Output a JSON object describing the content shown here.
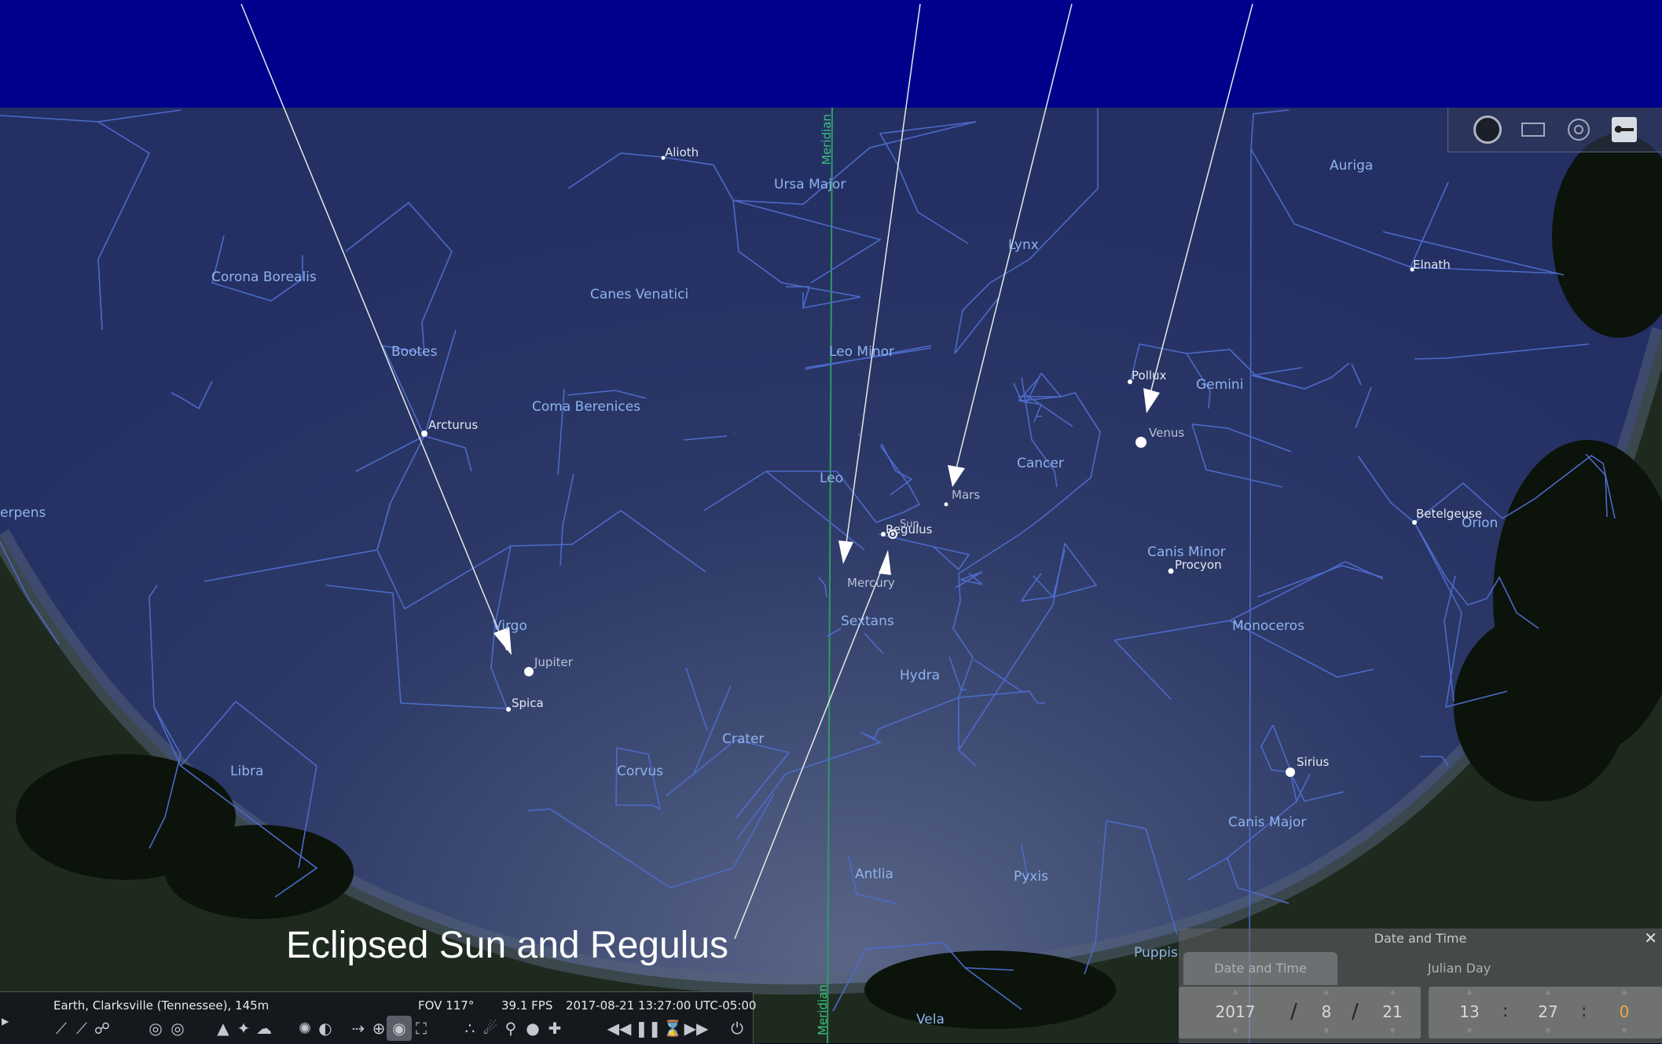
{
  "annotation": "Eclipsed Sun and Regulus",
  "meridian_label": "Meridian",
  "constellations": {
    "corona_borealis": "Corona Borealis",
    "bootes": "Bootes",
    "canes_venatici": "Canes Venatici",
    "ursa_major": "Ursa Major",
    "lynx": "Lynx",
    "auriga": "Auriga",
    "leo_minor": "Leo Minor",
    "coma_berenices": "Coma Berenices",
    "gemini": "Gemini",
    "cancer": "Cancer",
    "leo": "Leo",
    "serpens": "erpens",
    "canis_minor": "Canis Minor",
    "orion": "Orion",
    "virgo": "Virgo",
    "sextans": "Sextans",
    "monoceros": "Monoceros",
    "hydra": "Hydra",
    "crater": "Crater",
    "libra": "Libra",
    "corvus": "Corvus",
    "canis_major": "Canis Major",
    "antlia": "Antlia",
    "pyxis": "Pyxis",
    "puppis": "Puppis",
    "vela": "Vela"
  },
  "stars": {
    "alioth": "Alioth",
    "elnath": "Elnath",
    "arcturus": "Arcturus",
    "pollux": "Pollux",
    "regulus": "Regulus",
    "betelgeuse": "Betelgeuse",
    "procyon": "Procyon",
    "spica": "Spica",
    "sirius": "Sirius"
  },
  "planets": {
    "venus": "Venus",
    "mars": "Mars",
    "sun": "Sun",
    "mercury": "Mercury",
    "jupiter": "Jupiter"
  },
  "status": {
    "location": "Earth, Clarksville (Tennessee), 145m",
    "fov": "FOV 117°",
    "fps": "39.1 FPS",
    "datetime": "2017-08-21 13:27:00 UTC-05:00"
  },
  "toolbar_icons": [
    "constellation-lines-icon",
    "constellation-labels-icon",
    "constellation-art-icon",
    "equatorial-grid-icon",
    "azimuthal-grid-icon",
    "ground-icon",
    "cardinal-points-icon",
    "atmosphere-icon",
    "deep-sky-objects-icon",
    "planet-labels-icon",
    "equatorial-mount-icon",
    "center-selected-icon",
    "night-mode-icon",
    "fullscreen-icon",
    "exoplanets-icon",
    "meteor-showers-icon",
    "search-satellites-icon",
    "ocular-icon",
    "telescope-icon",
    "rewind-icon",
    "pause-icon",
    "real-time-icon",
    "fast-forward-icon",
    "quit-icon"
  ],
  "date_time_panel": {
    "title": "Date and Time",
    "tabs": [
      "Date and Time",
      "Julian Day"
    ],
    "year": "2017",
    "month": "8",
    "day": "21",
    "hour": "13",
    "minute": "27",
    "second": "0",
    "date_sep": "/",
    "time_sep": ":"
  },
  "colors": {
    "top_band": "#00008c",
    "constellation_lines": "#4d6ac9",
    "constellation_labels": "#8fb3ee",
    "meridian": "#2e9a63",
    "seconds_field": "#e8a84a"
  }
}
